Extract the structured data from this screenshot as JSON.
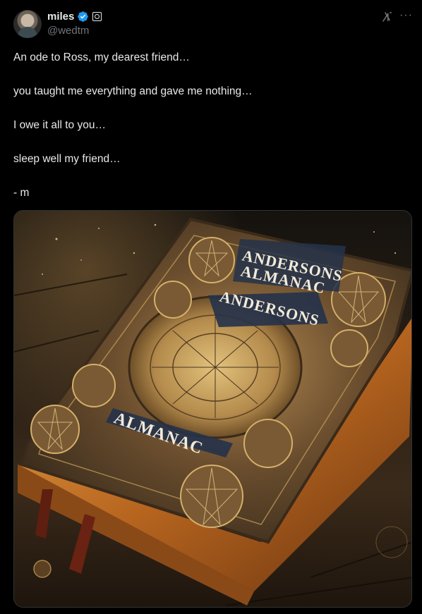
{
  "author": {
    "name": "miles",
    "handle": "@wedtm",
    "avatar_icon": "avatar",
    "verified_icon": "verified-badge-icon",
    "affiliation_icon": "affiliation-badge-icon"
  },
  "header_actions": {
    "grok_icon": "grok-icon",
    "more_label": "···"
  },
  "tweet": {
    "lines": [
      "An ode to Ross, my dearest friend…",
      "you taught me everything and gave me nothing…",
      "I owe it all to you…",
      "sleep well my friend…",
      "- m"
    ]
  },
  "media": {
    "book_title_top_line1": "ANDERSONS",
    "book_title_top_line2": "ALMANAC",
    "book_title_mid": "ANDERSONS",
    "book_title_bottom": "ALMANAC"
  },
  "colors": {
    "background": "#000000",
    "text": "#e7e9ea",
    "secondary": "#71767b",
    "verified": "#1d9bf0",
    "border": "#2f3336"
  }
}
